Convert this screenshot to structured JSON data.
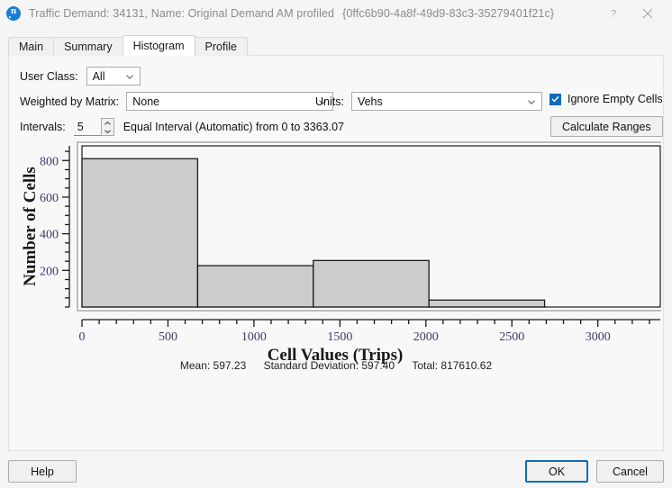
{
  "window": {
    "icon": "app-circle-n-icon",
    "title": "Traffic Demand: 34131, Name: Original Demand AM profiled",
    "guid": "{0ffc6b90-4a8f-49d9-83c3-35279401f21c}",
    "help_glyph": "?",
    "close_glyph": "×"
  },
  "tabs": [
    {
      "label": "Main",
      "active": false
    },
    {
      "label": "Summary",
      "active": false
    },
    {
      "label": "Histogram",
      "active": true
    },
    {
      "label": "Profile",
      "active": false
    }
  ],
  "form": {
    "user_class_label": "User Class:",
    "user_class_value": "All",
    "weighted_label": "Weighted by Matrix:",
    "weighted_value": "None",
    "units_label": "Units:",
    "units_value": "Vehs",
    "ignore_empty_label": "Ignore Empty Cells",
    "ignore_empty_checked": true,
    "intervals_label": "Intervals:",
    "intervals_value": "5",
    "interval_method_text": "Equal Interval (Automatic) from 0 to 3363.07",
    "calculate_ranges_label": "Calculate Ranges"
  },
  "stats": {
    "mean_label": "Mean: 597.23",
    "stddev_label": "Standard Deviation: 597.40",
    "total_label": "Total: 817610.62"
  },
  "footer": {
    "help_label": "Help",
    "ok_label": "OK",
    "cancel_label": "Cancel"
  },
  "colors": {
    "accent": "#0f6cbd",
    "bar_fill": "#cccccc",
    "bar_stroke": "#1a1a1a",
    "axis": "#1a1a1a",
    "tick_label": "#3c3c64",
    "plot_bg": "#f7f7f7",
    "panel_bg": "#f8f8f8"
  },
  "chart_data": {
    "type": "bar",
    "title": "",
    "xlabel": "Cell Values (Trips)",
    "ylabel": "Number of Cells",
    "xlim": [
      0,
      3363.07
    ],
    "ylim": [
      0,
      880
    ],
    "grid": false,
    "legend": null,
    "x_ticks": [
      0,
      500,
      1000,
      1500,
      2000,
      2500,
      3000
    ],
    "x_tick_labels": [
      "0",
      "500",
      "1000",
      "1500",
      "2000",
      "2500",
      "3000"
    ],
    "x_minor_step": 100,
    "y_ticks": [
      200,
      400,
      600,
      800
    ],
    "y_tick_labels": [
      "200",
      "400",
      "600",
      "800"
    ],
    "y_minor_step": 50,
    "bin_edges": [
      0,
      672.61,
      1345.23,
      2017.84,
      2690.46,
      3363.07
    ],
    "bin_labels": [
      "0 - 672.61",
      "672.61 - 1345.23",
      "1345.23 - 2017.84",
      "2017.84 - 2690.46",
      "2690.46 - 3363.07"
    ],
    "categories": [
      "0 - 672.61",
      "672.61 - 1345.23",
      "1345.23 - 2017.84",
      "2017.84 - 2690.46",
      "2690.46 - 3363.07"
    ],
    "values": [
      810,
      226,
      254,
      38,
      0
    ]
  }
}
